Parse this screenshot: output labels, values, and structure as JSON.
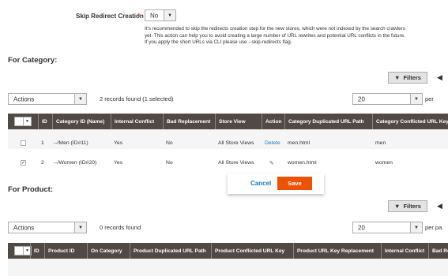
{
  "skip": {
    "label": "Skip Redirect Creation",
    "required_mark": "*",
    "value": "No",
    "note": "It's recommended to skip the redirects creation step for the new stores, which were not indexed by the search crawlers yet. This action can help you to avoid creating a large number of URL rewrites and potential URL conflicts in the future. If you apply the short URLs via CLI please use --skip-redirects flag."
  },
  "category": {
    "title": "For Category:",
    "filters_label": "Filters",
    "actions_label": "Actions",
    "records": "2 records found (1 selected)",
    "per_page_value": "20",
    "per_page_label": "per",
    "columns": [
      "ID",
      "Category ID (Name)",
      "Internal Conflict",
      "Bad Replacement",
      "Store View",
      "Action",
      "Category Duplicated URL Path",
      "Category Conflicted URL Key"
    ],
    "rows": [
      {
        "id": "1",
        "name": "--/Men (ID#11)",
        "internal": "Yes",
        "bad": "No",
        "store": "All Store Views",
        "action": "Delete",
        "dup": "men.html",
        "conf": "men",
        "checked": false
      },
      {
        "id": "2",
        "name": "--/Women (ID#20)",
        "internal": "Yes",
        "bad": "No",
        "store": "All Store Views",
        "action": "edit-icon",
        "dup": "women.html",
        "conf": "women",
        "checked": true
      }
    ],
    "cancel_label": "Cancel",
    "save_label": "Save"
  },
  "product": {
    "title": "For Product:",
    "filters_label": "Filters",
    "actions_label": "Actions",
    "records": "0 records found",
    "per_page_value": "20",
    "per_page_label": "per pa",
    "columns": [
      "ID",
      "Product ID",
      "On Category",
      "Product Duplicated URL Path",
      "Product Conflicted URL Key",
      "Product URL Key Replacement",
      "Internal Conflict",
      "Bad Re"
    ]
  },
  "colors": {
    "header": "#514943",
    "accent": "#eb5202",
    "link": "#1979c3"
  }
}
